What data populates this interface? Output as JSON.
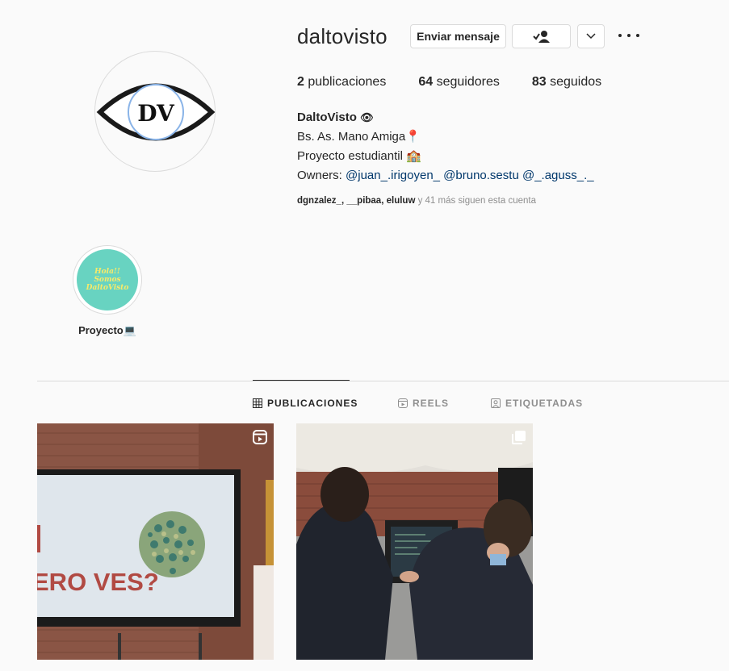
{
  "profile": {
    "username": "daltovisto",
    "avatar_text": "DV",
    "full_name": "DaltoVisto",
    "name_emoji": "👁",
    "bio_line1": "Bs. As. Mano Amiga📍",
    "bio_line2": "Proyecto estudiantil 🏫",
    "bio_owners_prefix": "Owners:",
    "owners": [
      "@juan_.irigoyen_",
      "@bruno.sestu",
      "@_.aguss_._"
    ],
    "followed_by": [
      "dgnzalez_",
      "__pibaa",
      "eluluw"
    ],
    "followed_by_suffix": "y 41 más siguen esta cuenta"
  },
  "actions": {
    "message_label": "Enviar mensaje"
  },
  "stats": [
    {
      "count": "2",
      "label": "publicaciones"
    },
    {
      "count": "64",
      "label": "seguidores"
    },
    {
      "count": "83",
      "label": "seguidos"
    }
  ],
  "highlight": {
    "cover_line1": "Hola!!",
    "cover_line2": "Somos",
    "cover_line3": "DaltoVisto",
    "label": "Proyecto💻"
  },
  "tabs": [
    {
      "label": "PUBLICACIONES",
      "icon": "grid-icon",
      "active": true
    },
    {
      "label": "REELS",
      "icon": "reels-icon",
      "active": false
    },
    {
      "label": "ETIQUETADAS",
      "icon": "tagged-icon",
      "active": false
    }
  ],
  "posts": [
    {
      "type": "reel",
      "badge_icon": "reel-badge-icon",
      "screen_text": "ERO VES?"
    },
    {
      "type": "carousel",
      "badge_icon": "carousel-badge-icon"
    }
  ],
  "colors": {
    "highlight_bg": "#68d3c1",
    "highlight_text": "#f7ea6a",
    "mention": "#00376b"
  }
}
